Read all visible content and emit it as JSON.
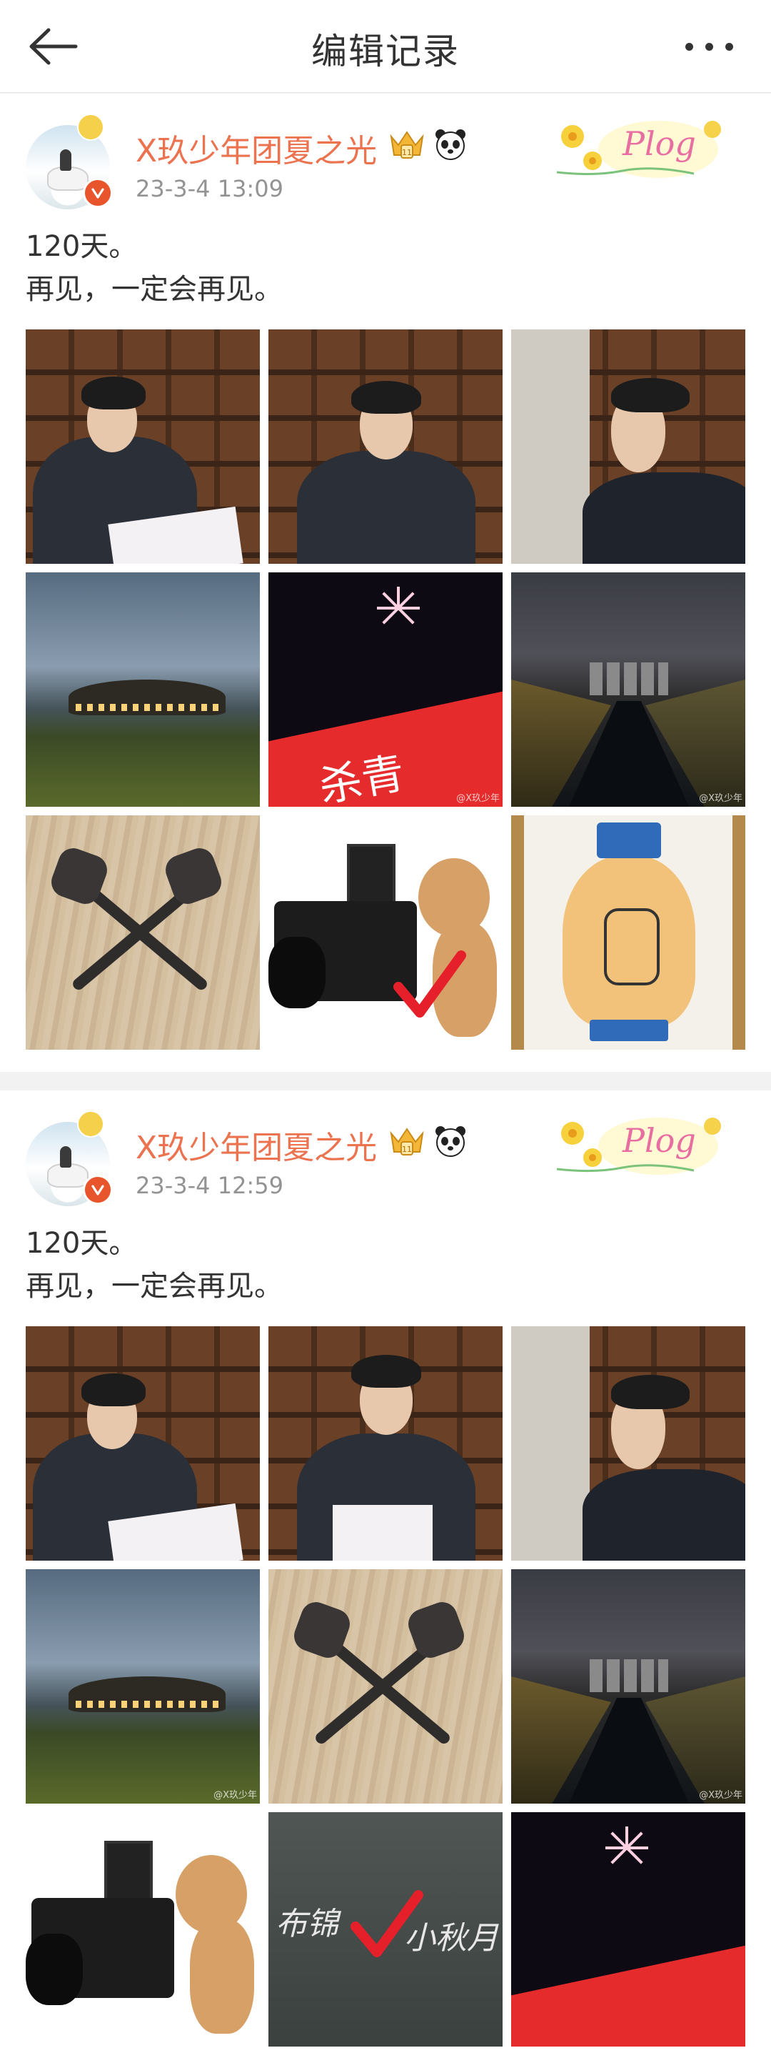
{
  "header": {
    "title": "编辑记录"
  },
  "posts": [
    {
      "username": "X玖少年团夏之光",
      "timestamp": "23-3-4 13:09",
      "text_lines": [
        "120天。",
        "再见，一定会再见。"
      ],
      "photos": [
        "reading-script",
        "portrait-shelf",
        "profile-shelf",
        "night-landscape",
        "fireworks-banner",
        "night-river",
        "crossed-keys",
        "camera-dog",
        "vase-painting"
      ],
      "banner_text": "杀青",
      "watermark": "@X玖少年"
    },
    {
      "username": "X玖少年团夏之光",
      "timestamp": "23-3-4 12:59",
      "text_lines": [
        "120天。",
        "再见，一定会再见。"
      ],
      "photos": [
        "reading-script",
        "portrait-shelf",
        "profile-shelf",
        "night-landscape",
        "crossed-keys",
        "night-river",
        "camera-dog",
        "chalk-writing",
        "fireworks-banner"
      ],
      "chalk_text_left": "布锦",
      "chalk_text_right": "小秋月",
      "watermark": "@X玖少年"
    }
  ],
  "colors": {
    "username": "#eb7350",
    "timestamp": "#939393",
    "verified": "#e8542b",
    "check": "#e5202a"
  },
  "icons": {
    "back": "arrow-left-icon",
    "more": "more-dots-icon",
    "crown": "crown-icon",
    "panda": "panda-icon",
    "plog": "plog-sticker-icon"
  }
}
